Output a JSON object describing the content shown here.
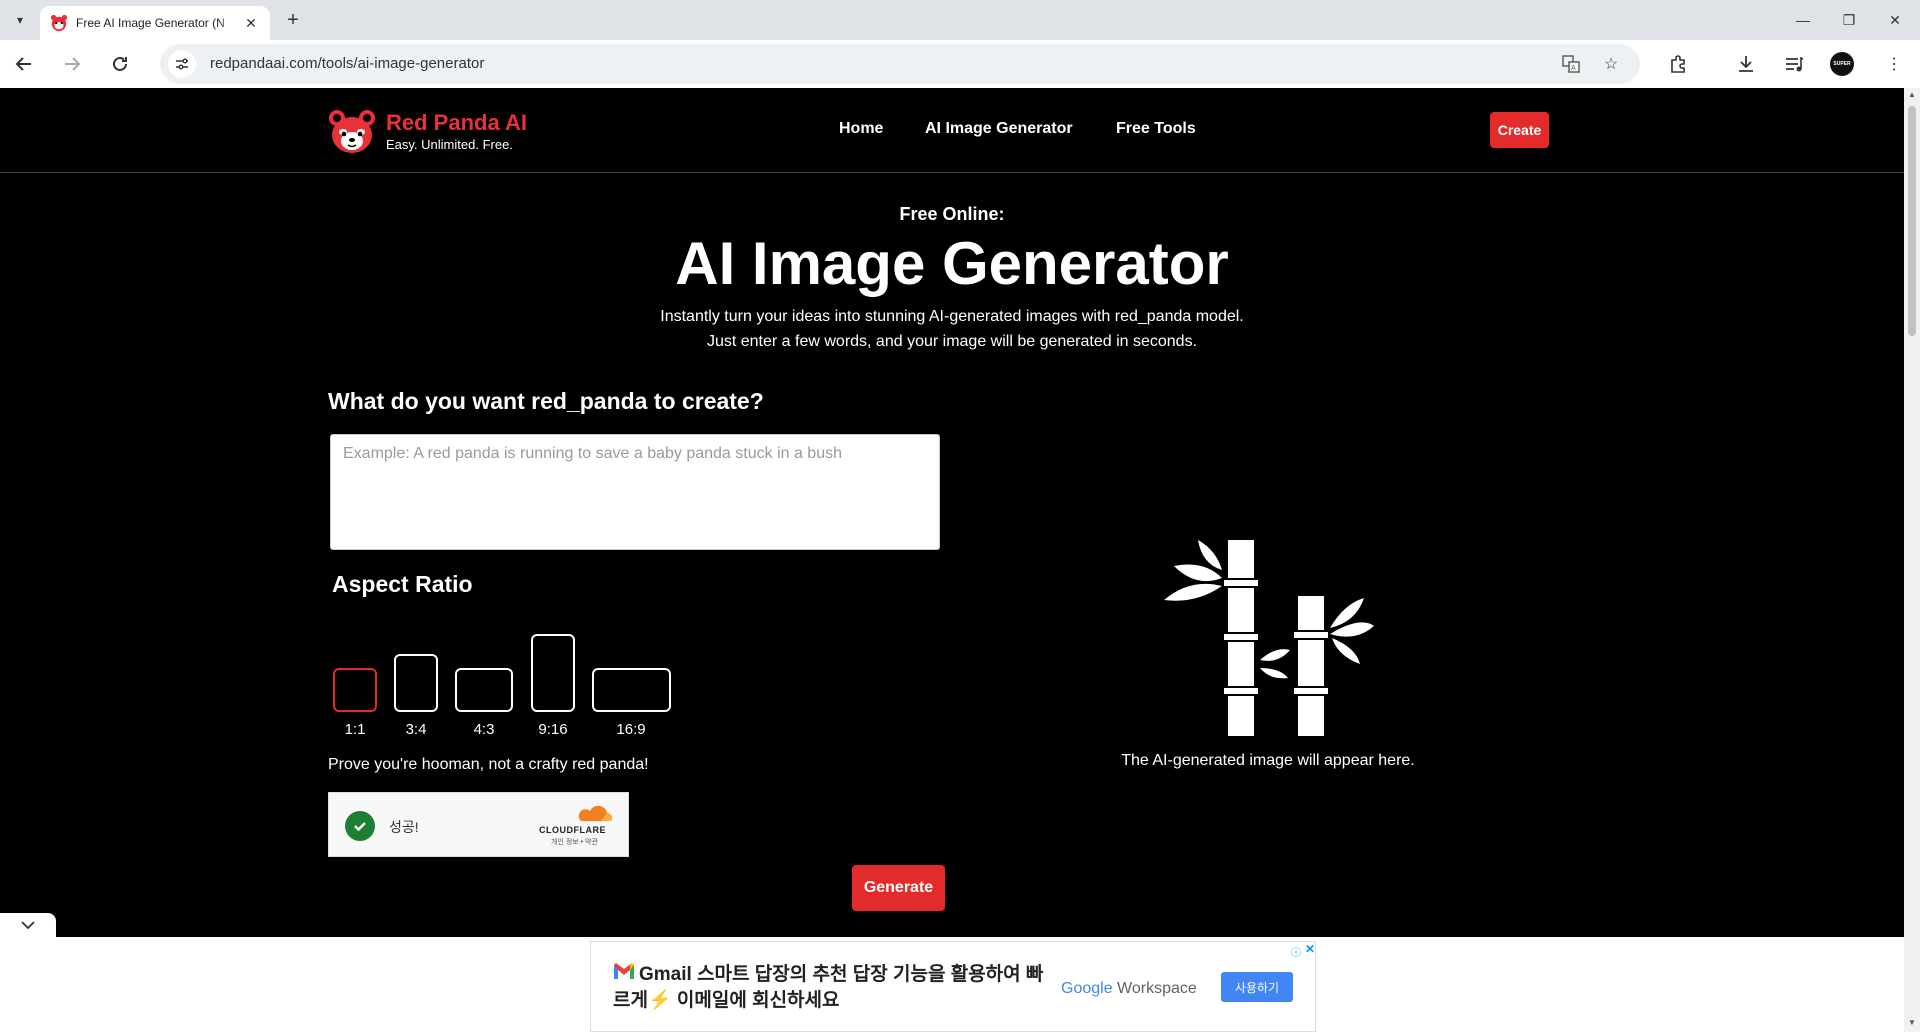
{
  "browser": {
    "tab_title": "Free AI Image Generator (N",
    "url": "redpandaai.com/tools/ai-image-generator",
    "profile_label": "SUPER"
  },
  "header": {
    "brand": "Red Panda AI",
    "tagline": "Easy. Unlimited. Free.",
    "nav": [
      "Home",
      "AI Image Generator",
      "Free Tools"
    ],
    "create_label": "Create"
  },
  "hero": {
    "kicker": "Free Online:",
    "title": "AI Image Generator",
    "description": "Instantly turn your ideas into stunning AI-generated images with red_panda model. Just enter a few words, and your image will be generated in seconds."
  },
  "form": {
    "prompt_heading": "What do you want red_panda to create?",
    "prompt_placeholder": "Example: A red panda is running to save a baby panda stuck in a bush",
    "prompt_value": "",
    "aspect_heading": "Aspect Ratio",
    "ratios": [
      "1:1",
      "3:4",
      "4:3",
      "9:16",
      "16:9"
    ],
    "selected_ratio": "1:1",
    "captcha_prompt": "Prove you're hooman, not a crafty red panda!",
    "captcha_status": "성공!",
    "captcha_brand": "CLOUDFLARE",
    "captcha_links": "개인 정보 • 약관",
    "generate_label": "Generate"
  },
  "preview": {
    "placeholder_text": "The AI-generated image will appear here."
  },
  "ad": {
    "headline": "Gmail 스마트 답장의 추천 답장 기능을 활용하여 빠르게⚡ 이메일에 회신하세요",
    "brand_google": "Google",
    "brand_workspace": "Workspace",
    "cta": "사용하기",
    "close": "✕",
    "info": "ⓘ"
  },
  "colors": {
    "accent": "#e32b2b",
    "page_bg": "#000000",
    "brand_red": "#e8323a"
  }
}
